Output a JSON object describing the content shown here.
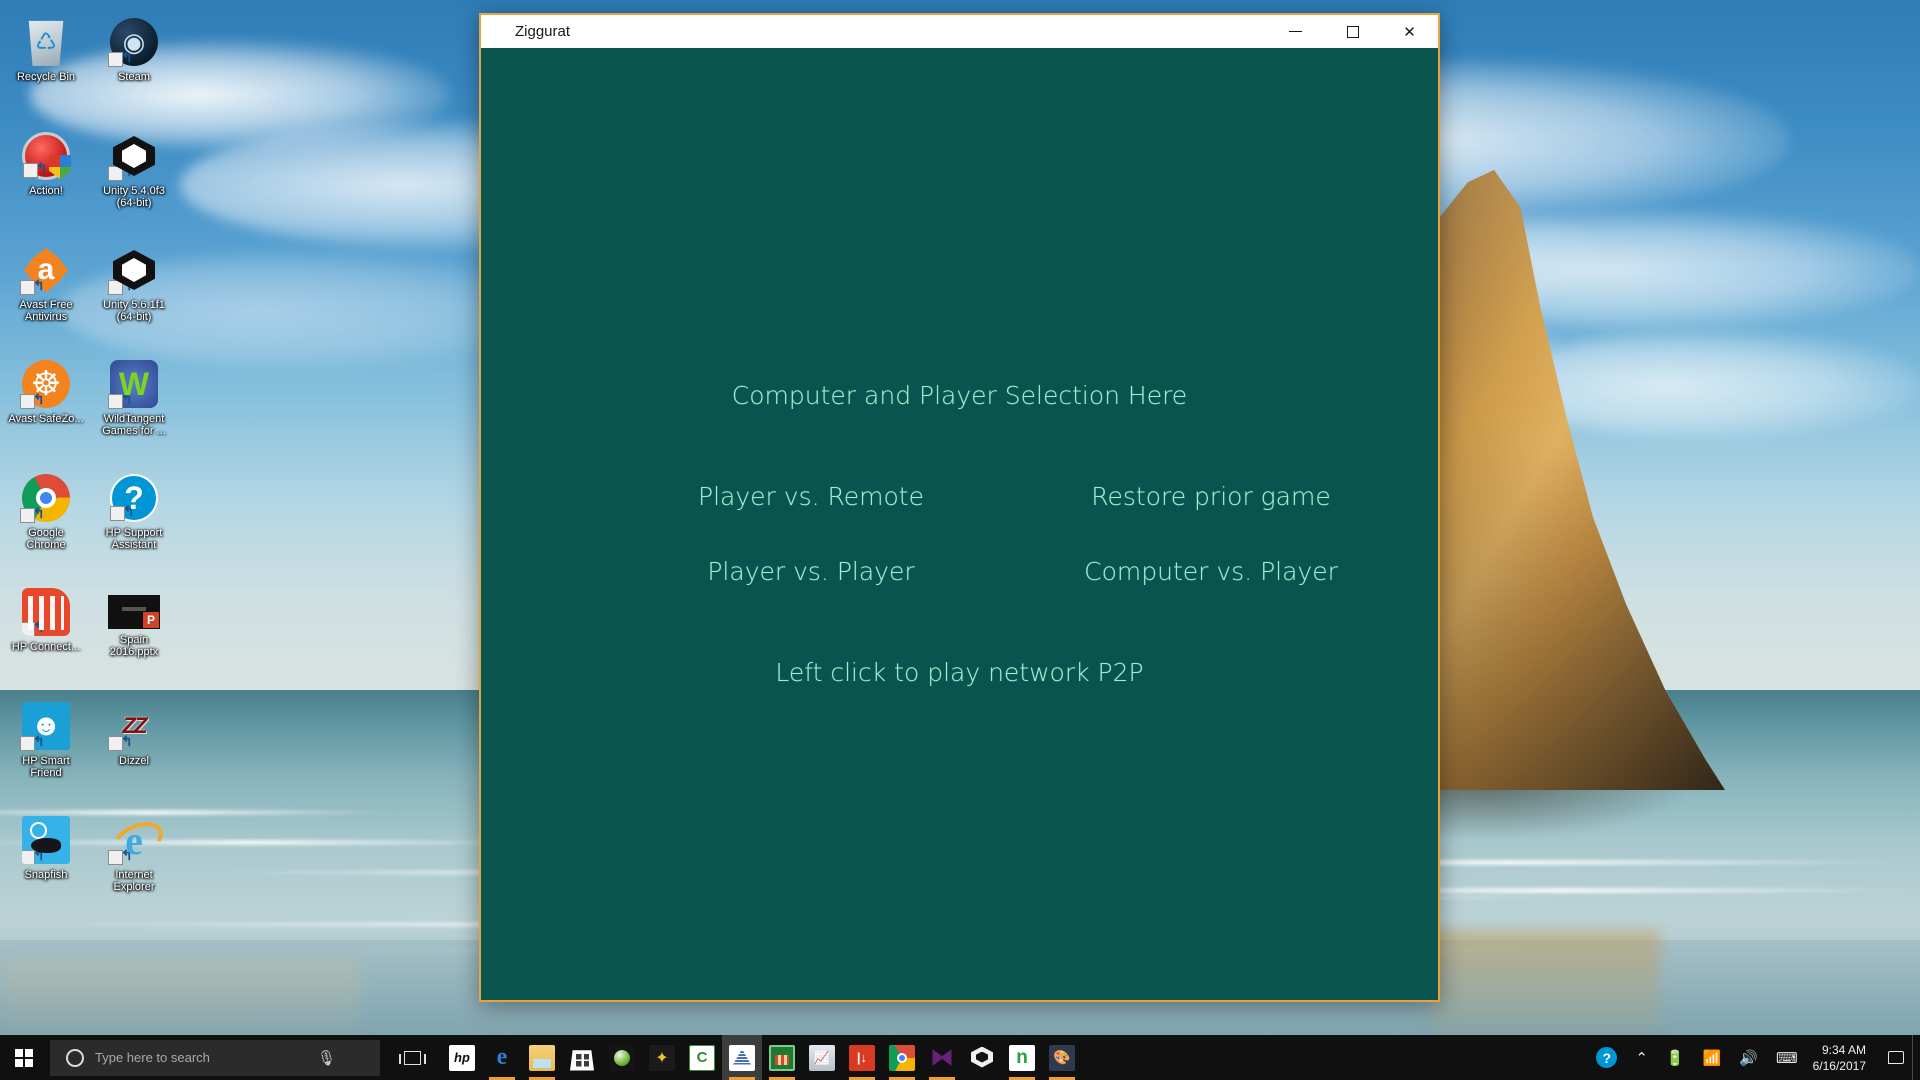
{
  "desktop": {
    "icons": [
      {
        "label": "Recycle Bin",
        "icon": "recycle-bin-icon",
        "cls": "ic-recycle",
        "shortcut": false
      },
      {
        "label": "Steam",
        "icon": "steam-icon",
        "cls": "ic-steam",
        "shortcut": true
      },
      {
        "label": "Action!",
        "icon": "action-icon",
        "cls": "ic-action",
        "shortcut": true
      },
      {
        "label": "Unity 5.4.0f3 (64-bit)",
        "icon": "unity-icon",
        "cls": "ic-unity",
        "shortcut": true
      },
      {
        "label": "Avast Free Antivirus",
        "icon": "avast-icon",
        "cls": "ic-avast",
        "shortcut": true
      },
      {
        "label": "Unity 5.6.1f1 (64-bit)",
        "icon": "unity-icon",
        "cls": "ic-unity",
        "shortcut": true
      },
      {
        "label": "Avast SafeZo...",
        "icon": "avast-safezone-icon",
        "cls": "ic-safezone",
        "shortcut": true
      },
      {
        "label": "WildTangent Games for ...",
        "icon": "wildtangent-icon",
        "cls": "ic-wild",
        "shortcut": true
      },
      {
        "label": "Google Chrome",
        "icon": "chrome-icon",
        "cls": "ic-chrome",
        "shortcut": true
      },
      {
        "label": "HP Support Assistant",
        "icon": "hp-support-icon",
        "cls": "ic-hpsupport",
        "shortcut": true
      },
      {
        "label": "HP Connect...",
        "icon": "hp-connect-icon",
        "cls": "ic-hpconnect",
        "shortcut": true
      },
      {
        "label": "Spain 2016.pptx",
        "icon": "powerpoint-file-icon",
        "cls": "ic-pptx",
        "shortcut": false
      },
      {
        "label": "HP Smart Friend",
        "icon": "hp-smart-friend-icon",
        "cls": "ic-hpsmart",
        "shortcut": true
      },
      {
        "label": "Dizzel",
        "icon": "dizzel-icon",
        "cls": "ic-dizzel",
        "shortcut": true
      },
      {
        "label": "Snapfish",
        "icon": "snapfish-icon",
        "cls": "ic-snapfish",
        "shortcut": true
      },
      {
        "label": "Internet Explorer",
        "icon": "internet-explorer-icon",
        "cls": "ic-ie",
        "shortcut": true
      }
    ]
  },
  "window": {
    "title": "Ziggurat",
    "icon": "ziggurat-icon",
    "background_color": "#0a5450",
    "text_color": "#96f2d0",
    "border_color": "#e8a33d",
    "controls": {
      "minimize": "minimize-button",
      "maximize": "maximize-button",
      "close": "close-button"
    },
    "content": {
      "heading": "Computer and Player Selection Here",
      "options": [
        {
          "label": "Player vs. Remote",
          "name": "option-player-vs-remote"
        },
        {
          "label": "Restore prior game",
          "name": "option-restore-prior-game"
        },
        {
          "label": "Player vs. Player",
          "name": "option-player-vs-player"
        },
        {
          "label": "Computer vs. Player",
          "name": "option-computer-vs-player"
        }
      ],
      "hint": "Left click to play network P2P"
    }
  },
  "taskbar": {
    "start": "start-button",
    "search": {
      "placeholder": "Type here to search",
      "value": ""
    },
    "task_view": "task-view-button",
    "apps": [
      {
        "name": "taskbar-app-hp",
        "cls": "ta-hp",
        "open": false,
        "active": false
      },
      {
        "name": "taskbar-app-edge",
        "cls": "ta-edge",
        "open": true,
        "active": false
      },
      {
        "name": "taskbar-app-file-explorer",
        "cls": "ta-folder",
        "open": true,
        "active": false
      },
      {
        "name": "taskbar-app-microsoft-store",
        "cls": "ta-store",
        "open": false,
        "active": false
      },
      {
        "name": "taskbar-app-action-recorder",
        "cls": "ta-action2",
        "open": false,
        "active": false
      },
      {
        "name": "taskbar-app-games",
        "cls": "ta-games",
        "open": false,
        "active": false
      },
      {
        "name": "taskbar-app-cyberlink",
        "cls": "ta-cyber",
        "open": false,
        "active": false
      },
      {
        "name": "taskbar-app-ziggurat",
        "cls": "ta-zig",
        "open": true,
        "active": true
      },
      {
        "name": "taskbar-app-green-tool",
        "cls": "ta-green",
        "open": true,
        "active": false
      },
      {
        "name": "taskbar-app-system-monitor",
        "cls": "ta-monitor",
        "open": false,
        "active": false
      },
      {
        "name": "taskbar-app-red-tool",
        "cls": "ta-red",
        "open": true,
        "active": false
      },
      {
        "name": "taskbar-app-chrome",
        "cls": "ta-chrome",
        "open": true,
        "active": false
      },
      {
        "name": "taskbar-app-visual-studio",
        "cls": "ta-vs",
        "open": true,
        "active": false
      },
      {
        "name": "taskbar-app-unity",
        "cls": "ta-unity",
        "open": false,
        "active": false
      },
      {
        "name": "taskbar-app-nsoft",
        "cls": "ta-nsoft",
        "open": true,
        "active": false
      },
      {
        "name": "taskbar-app-paint",
        "cls": "ta-paint",
        "open": true,
        "active": false
      }
    ],
    "tray": [
      {
        "name": "tray-hp-support-icon",
        "glyph": "",
        "cls": "tray-hp"
      },
      {
        "name": "tray-show-hidden-icons",
        "glyph": "⌃",
        "cls": ""
      },
      {
        "name": "tray-battery-icon",
        "glyph": "🔋",
        "cls": ""
      },
      {
        "name": "tray-network-icon",
        "glyph": "📶",
        "cls": ""
      },
      {
        "name": "tray-volume-icon",
        "glyph": "🔊",
        "cls": ""
      },
      {
        "name": "tray-keyboard-icon",
        "glyph": "⌨",
        "cls": ""
      }
    ],
    "clock": {
      "time": "9:34 AM",
      "date": "6/16/2017"
    },
    "notifications": "notification-center-button"
  }
}
